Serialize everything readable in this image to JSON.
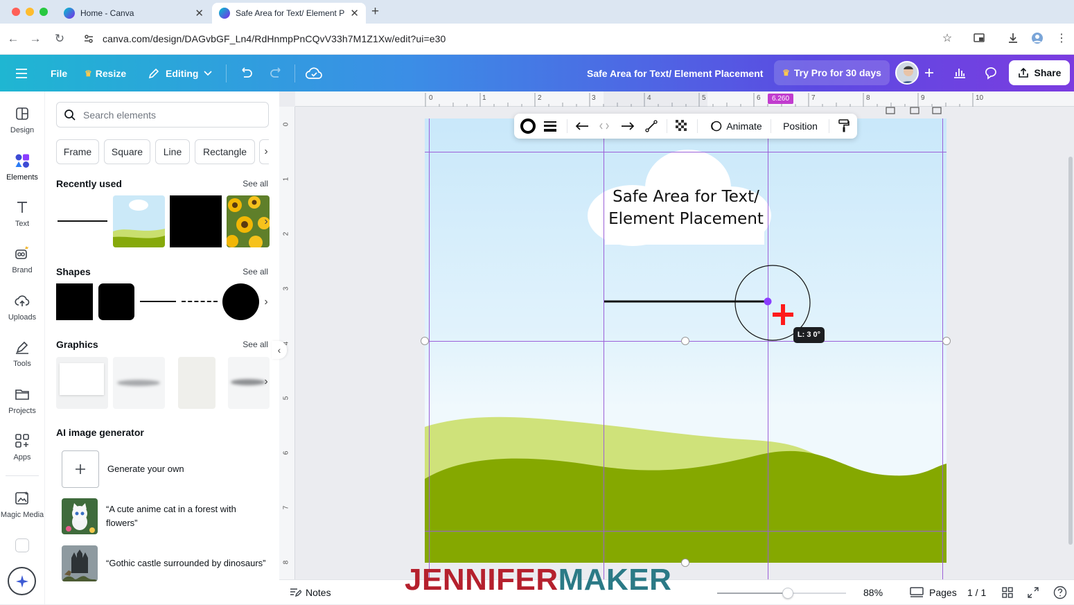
{
  "browser": {
    "tabs": [
      {
        "title": "Home - Canva",
        "active": false
      },
      {
        "title": "Safe Area for Text/ Element Pl",
        "active": true
      }
    ],
    "url": "canva.com/design/DAGvbGF_Ln4/RdHnmpPnCQvV33h7M1Z1Xw/edit?ui=e30"
  },
  "header": {
    "file_label": "File",
    "resize_label": "Resize",
    "editing_label": "Editing",
    "doc_title": "Safe Area for Text/ Element Placement",
    "pro_label": "Try Pro for 30 days",
    "share_label": "Share"
  },
  "rail": [
    {
      "label": "Design",
      "icon": "layout-icon"
    },
    {
      "label": "Elements",
      "icon": "shapes-icon"
    },
    {
      "label": "Text",
      "icon": "text-icon"
    },
    {
      "label": "Brand",
      "icon": "brand-icon"
    },
    {
      "label": "Uploads",
      "icon": "upload-cloud-icon"
    },
    {
      "label": "Tools",
      "icon": "pen-tool-icon"
    },
    {
      "label": "Projects",
      "icon": "folder-icon"
    },
    {
      "label": "Apps",
      "icon": "apps-icon"
    },
    {
      "label": "Magic Media",
      "icon": "magic-media-icon"
    }
  ],
  "panel": {
    "search_placeholder": "Search elements",
    "chips": [
      "Frame",
      "Square",
      "Line",
      "Rectangle"
    ],
    "recently_used": "Recently used",
    "shapes": "Shapes",
    "graphics": "Graphics",
    "see_all": "See all",
    "ai_heading": "AI image generator",
    "generate_label": "Generate your own",
    "prompts": [
      "“A cute anime cat in a forest with flowers”",
      "“Gothic castle surrounded by dinosaurs”"
    ]
  },
  "rulers": {
    "top": [
      "0",
      "1",
      "2",
      "3",
      "4",
      "5",
      "6",
      "7",
      "8",
      "9",
      "10"
    ],
    "left": [
      "0",
      "1",
      "2",
      "3",
      "4",
      "5",
      "6",
      "7",
      "8"
    ],
    "marker": "6.260"
  },
  "canvas_toolbar": {
    "animate_label": "Animate",
    "position_label": "Position"
  },
  "canvas": {
    "title_line1": "Safe Area for Text/",
    "title_line2": "Element Placement",
    "line_badge": "L: 3 0°"
  },
  "bottom": {
    "notes_label": "Notes",
    "zoom": "88%",
    "zoom_level": 0.55,
    "pages_label": "Pages",
    "page_count": "1 / 1"
  },
  "watermark": {
    "part1": "JENNIFER",
    "part2": "MAKER",
    "color1": "#b5202d",
    "color2": "#2b7a86"
  },
  "colors": {
    "guide": "#9b5fd8",
    "ruler_marker": "#c13ccf",
    "hill_dark": "#85a800",
    "hill_light": "#cfe27a"
  }
}
